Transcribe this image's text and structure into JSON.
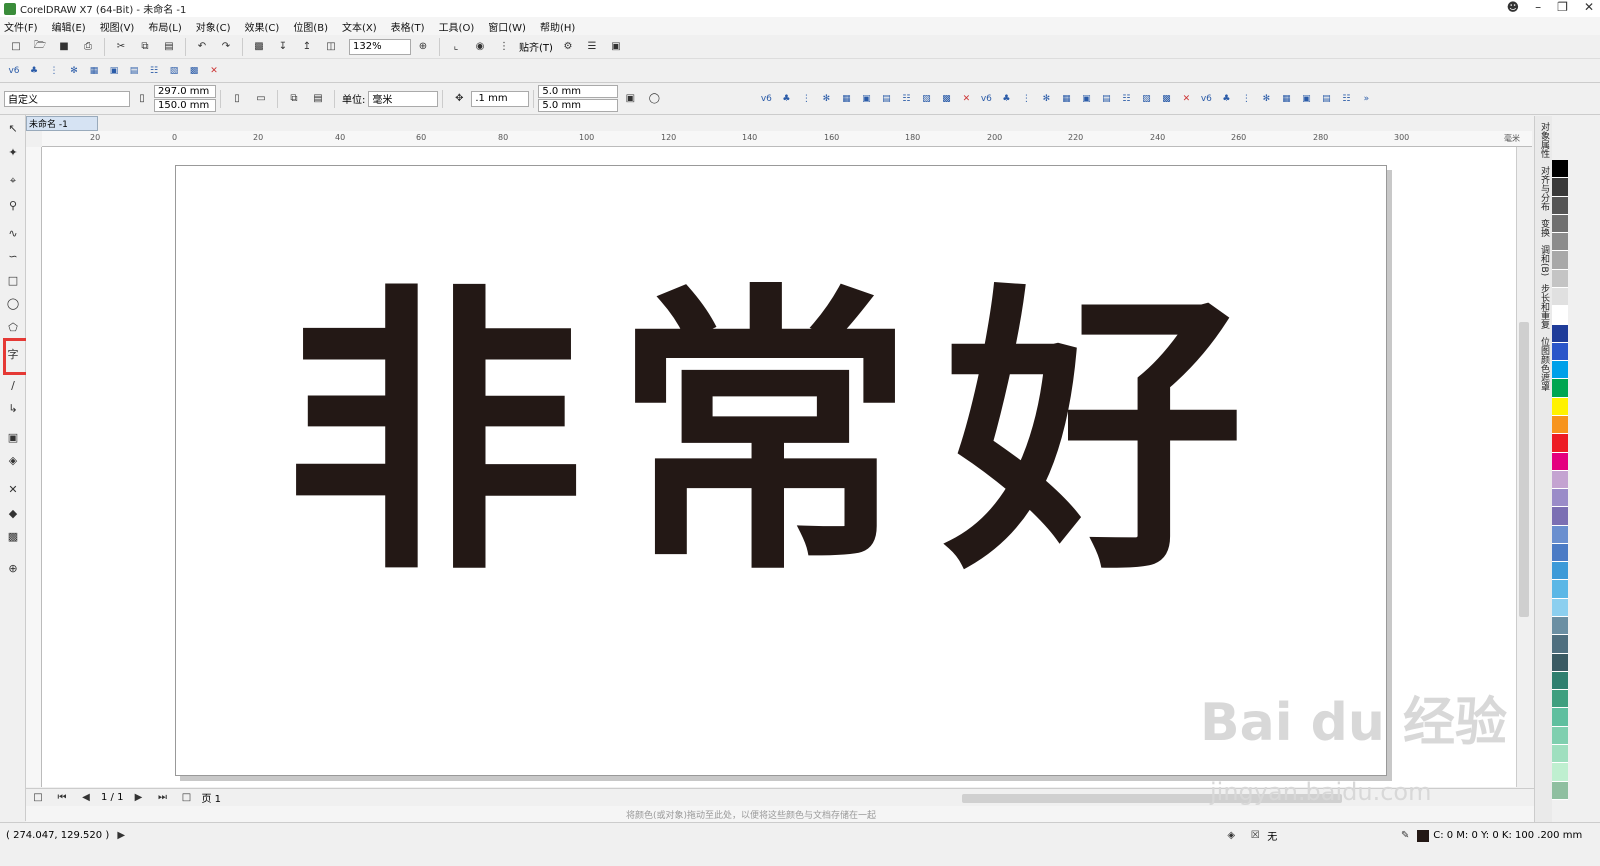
{
  "title": "CorelDRAW X7 (64-Bit) - 未命名 -1",
  "menu": [
    "文件(F)",
    "编辑(E)",
    "视图(V)",
    "布局(L)",
    "对象(C)",
    "效果(C)",
    "位图(B)",
    "文本(X)",
    "表格(T)",
    "工具(O)",
    "窗口(W)",
    "帮助(H)"
  ],
  "toolbar": {
    "zoom": "132%",
    "snap": "贴齐(T)"
  },
  "propbar": {
    "preset": "自定义",
    "width": "297.0 mm",
    "height": "150.0 mm",
    "unit_label": "单位:",
    "unit": "毫米",
    "nudge": ".1 mm",
    "dup_x": "5.0 mm",
    "dup_y": "5.0 mm"
  },
  "doc_tab": "未命名 -1",
  "ruler_ticks": [
    "20",
    "0",
    "20",
    "40",
    "60",
    "80",
    "100",
    "120",
    "140",
    "160",
    "180",
    "200",
    "220",
    "240",
    "260",
    "280",
    "300"
  ],
  "ruler_unit": "毫米",
  "canvas_text": "非常好",
  "dockers": [
    "对象属性",
    "对齐与分布",
    "变换",
    "调和(B)",
    "步长和重复",
    "位图颜色遮罩"
  ],
  "pagebar": {
    "counter": "1 / 1",
    "page_tab": "页 1"
  },
  "hint": "将颜色(或对象)拖动至此处，以便将这些颜色与文档存储在一起",
  "status": {
    "coords": "( 274.047, 129.520 )",
    "fill_none": "无",
    "color_info": "C: 0 M: 0 Y: 0 K: 100  .200 mm"
  },
  "watermark": {
    "brand": "Bai du 经验",
    "url": "jingyan.baidu.com"
  },
  "colors": {
    "text": "#231815",
    "highlight": "#e53935"
  },
  "palette": [
    "#000000",
    "#3a3a3a",
    "#555555",
    "#707070",
    "#8c8c8c",
    "#a8a8a8",
    "#c4c4c4",
    "#e0e0e0",
    "#ffffff",
    "#1f3c99",
    "#2b56c9",
    "#00a0e9",
    "#00a651",
    "#fff200",
    "#f7941d",
    "#ed1c24",
    "#e4007f",
    "#c4a3d1",
    "#9a8cc8",
    "#7b6fb3",
    "#6a8fcf",
    "#4b7bc5",
    "#3d9ad8",
    "#5bb7e6",
    "#8ccfef",
    "#6b8fa3",
    "#4f6f7f",
    "#3a5a63",
    "#2f7f6f",
    "#3f9f7f",
    "#5fbf9f",
    "#7fcfaf",
    "#9fdfbf",
    "#bfefd0",
    "#8fbfa0"
  ]
}
